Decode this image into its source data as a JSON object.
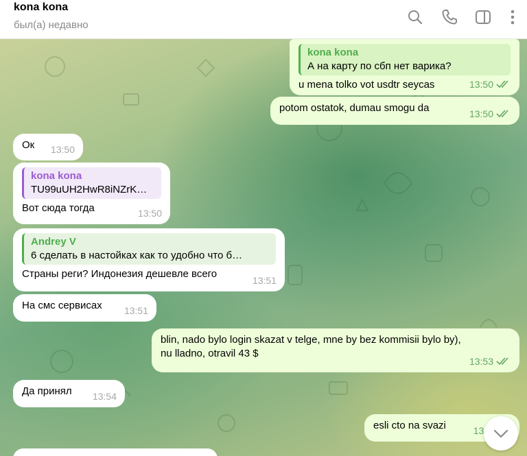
{
  "header": {
    "title": "kona kona",
    "status": "был(а) недавно",
    "icons": [
      "search-icon",
      "phone-icon",
      "sidebar-icon",
      "more-icon"
    ]
  },
  "messages": [
    {
      "dir": "out",
      "reply_name": "kona kona",
      "reply_text": "А на карту по сбп нет варика?",
      "text": "u mena tolko vot usdtr seycas",
      "time": "13:50",
      "read": true
    },
    {
      "dir": "out",
      "text": "potom ostatok, dumau smogu da",
      "time": "13:50",
      "read": true
    },
    {
      "dir": "in",
      "text": "Ок",
      "time": "13:50"
    },
    {
      "dir": "in",
      "reply_name": "kona kona",
      "reply_text": "TU99uUH2HwR8iNZrK…",
      "text": "Вот сюда тогда",
      "time": "13:50"
    },
    {
      "dir": "in",
      "reply_name": "Andrey V",
      "reply_text": "6 сделать в настойках как то удобно что б…",
      "text": "Страны реги? Индонезия дешевле всего",
      "time": "13:51"
    },
    {
      "dir": "in",
      "text": "На смс сервисах",
      "time": "13:51"
    },
    {
      "dir": "out",
      "text_lines": [
        "blin, nado bylo login skazat v telge, mne by bez kommisii bylo by),",
        "nu lladno, otravil 43 $"
      ],
      "time": "13:53",
      "read": true
    },
    {
      "dir": "in",
      "text": "Да принял",
      "time": "13:54"
    },
    {
      "dir": "out",
      "text": "esli cto na svazi",
      "time": "13:5"
    }
  ],
  "colors": {
    "outgoing_bubble": "#eefed9",
    "incoming_bubble": "#ffffff",
    "reply_green": "#4fae4e",
    "reply_purple": "#9a5cd0"
  },
  "scroll_button_icon": "chevron-down-icon"
}
